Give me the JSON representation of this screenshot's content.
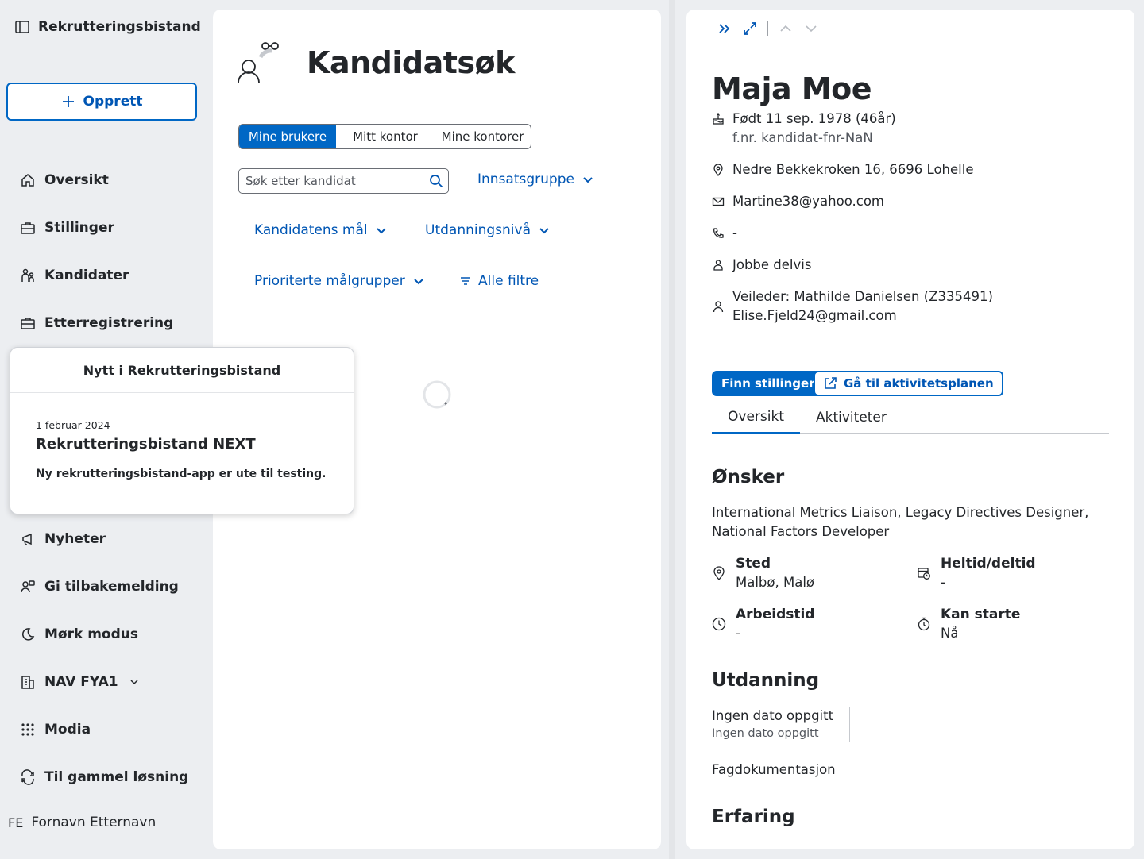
{
  "sidebar": {
    "brand": "Rekrutteringsbistand",
    "create_label": "Opprett",
    "items": {
      "oversikt": "Oversikt",
      "stillinger": "Stillinger",
      "kandidater": "Kandidater",
      "etterregistrering": "Etterregistrering",
      "nyheter": "Nyheter",
      "tilbakemelding": "Gi tilbakemelding",
      "mork_modus": "Mørk modus",
      "kontor": "NAV FYA1",
      "modia": "Modia",
      "gammel": "Til gammel løsning"
    },
    "user": {
      "initials": "FE",
      "name": "Fornavn Etternavn"
    }
  },
  "main": {
    "title": "Kandidatsøk",
    "segments": [
      "Mine brukere",
      "Mitt kontor",
      "Mine kontorer"
    ],
    "active_segment": "Mine brukere",
    "search_placeholder": "Søk etter kandidat",
    "filters": {
      "innsatsgruppe": "Innsatsgruppe",
      "mal": "Kandidatens mål",
      "utdanning": "Utdanningsnivå",
      "malgrupper": "Prioriterte målgrupper",
      "alle": "Alle filtre"
    }
  },
  "popover": {
    "title": "Nytt i Rekrutteringsbistand",
    "date": "1 februar 2024",
    "heading": "Rekrutteringsbistand NEXT",
    "body": "Ny rekrutteringsbistand-app er ute til testing."
  },
  "candidate": {
    "name": "Maja Moe",
    "born": "Født 11 sep. 1978 (46år)",
    "fnr": "f.nr. kandidat-fnr-NaN",
    "address": "Nedre Bekkekroken 16, 6696 Lohelle",
    "email": "Martine38@yahoo.com",
    "phone": "-",
    "goal": "Jobbe delvis",
    "veileder": "Veileder: Mathilde Danielsen (Z335491)",
    "veileder_email": "Elise.Fjeld24@gmail.com",
    "btn_finn": "Finn stillinger",
    "btn_aktivitet": "Gå til aktivitetsplanen",
    "tabs": [
      "Oversikt",
      "Aktiviteter"
    ],
    "active_tab": "Oversikt",
    "onsker_title": "Ønsker",
    "onsker_text": "International Metrics Liaison, Legacy Directives Designer, National Factors Developer",
    "facts": {
      "sted": {
        "label": "Sted",
        "value": "Malbø, Malø"
      },
      "heltid": {
        "label": "Heltid/deltid",
        "value": "-"
      },
      "arbeidstid": {
        "label": "Arbeidstid",
        "value": "-"
      },
      "kanstarte": {
        "label": "Kan starte",
        "value": "Nå"
      }
    },
    "utdanning_title": "Utdanning",
    "utdanning": [
      {
        "title": "Ingen dato oppgitt",
        "sub": "Ingen dato oppgitt"
      },
      {
        "title": "Fagdokumentasjon"
      }
    ],
    "erfaring_title": "Erfaring"
  },
  "colors": {
    "accent": "#0067c5",
    "link": "#0056b4",
    "text": "#23262a",
    "background": "#eceef1"
  }
}
